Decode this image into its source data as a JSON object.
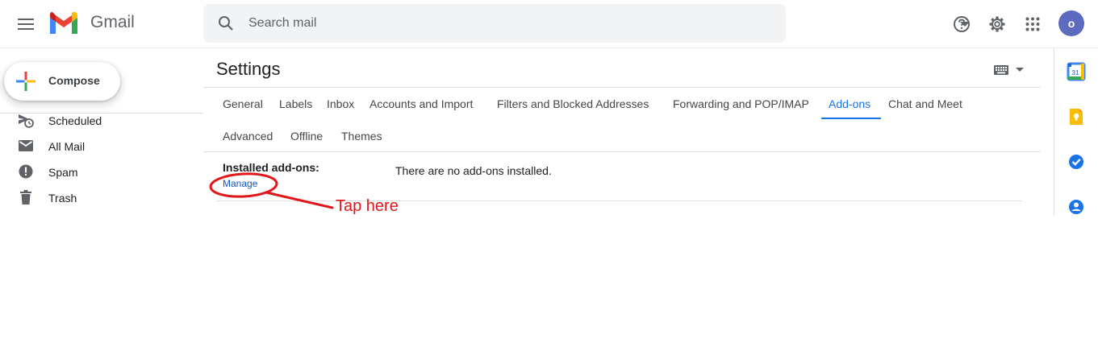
{
  "header": {
    "app_name": "Gmail",
    "search_placeholder": "Search mail",
    "avatar_letter": "o",
    "icons": [
      "menu-icon",
      "gmail-logo",
      "search-icon",
      "search-options-icon",
      "help-icon",
      "settings-icon",
      "apps-icon"
    ]
  },
  "nav": {
    "compose_label": "Compose",
    "items": [
      {
        "label": "Scheduled",
        "icon": "scheduled-icon"
      },
      {
        "label": "All Mail",
        "icon": "all-mail-icon"
      },
      {
        "label": "Spam",
        "icon": "spam-icon"
      },
      {
        "label": "Trash",
        "icon": "trash-icon"
      }
    ]
  },
  "settings": {
    "title": "Settings",
    "tabs": [
      "General",
      "Labels",
      "Inbox",
      "Accounts and Import",
      "Filters and Blocked Addresses",
      "Forwarding and POP/IMAP",
      "Add-ons",
      "Chat and Meet",
      "Advanced",
      "Offline",
      "Themes"
    ],
    "active_tab": "Add-ons",
    "installed_label": "Installed add-ons:",
    "manage_link": "Manage",
    "installed_value": "There are no add-ons installed."
  },
  "annotation": {
    "text": "Tap here",
    "color": "#e2161b"
  },
  "side_panel": {
    "icons": [
      "calendar-icon",
      "keep-icon",
      "tasks-icon",
      "contacts-icon"
    ],
    "calendar_day": "31"
  },
  "colors": {
    "accent": "#1a73e8",
    "link": "#1155cc",
    "avatar": "#5c6bc0",
    "annotation": "#e2161b"
  }
}
